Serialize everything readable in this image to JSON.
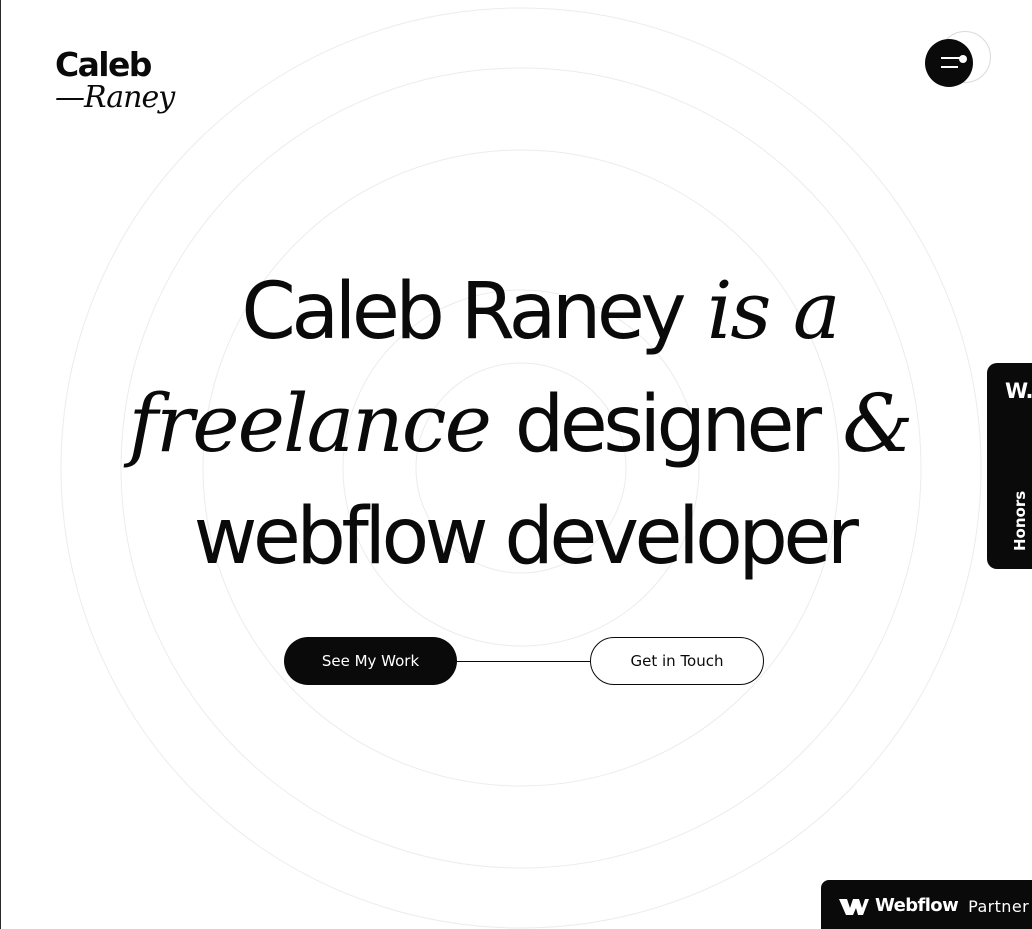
{
  "logo": {
    "first": "Caleb",
    "second": "—Raney"
  },
  "menu": {
    "icon": "menu-icon"
  },
  "hero": {
    "line1": {
      "sans": "Caleb Raney",
      "serif": "is a"
    },
    "line2": {
      "serif_a": "freelance",
      "sans": "designer",
      "serif_b": "&"
    },
    "line3": {
      "sans": "webflow developer"
    }
  },
  "cta": {
    "primary_label": "See My Work",
    "secondary_label": "Get in Touch"
  },
  "awards_tab": {
    "badge": "W.",
    "label": "Honors"
  },
  "partner": {
    "brand": "Webflow",
    "word": "Partner",
    "icon": "webflow-logo-icon"
  },
  "colors": {
    "ink": "#0a0a0a",
    "background": "#ffffff",
    "ring": "#ececec"
  }
}
